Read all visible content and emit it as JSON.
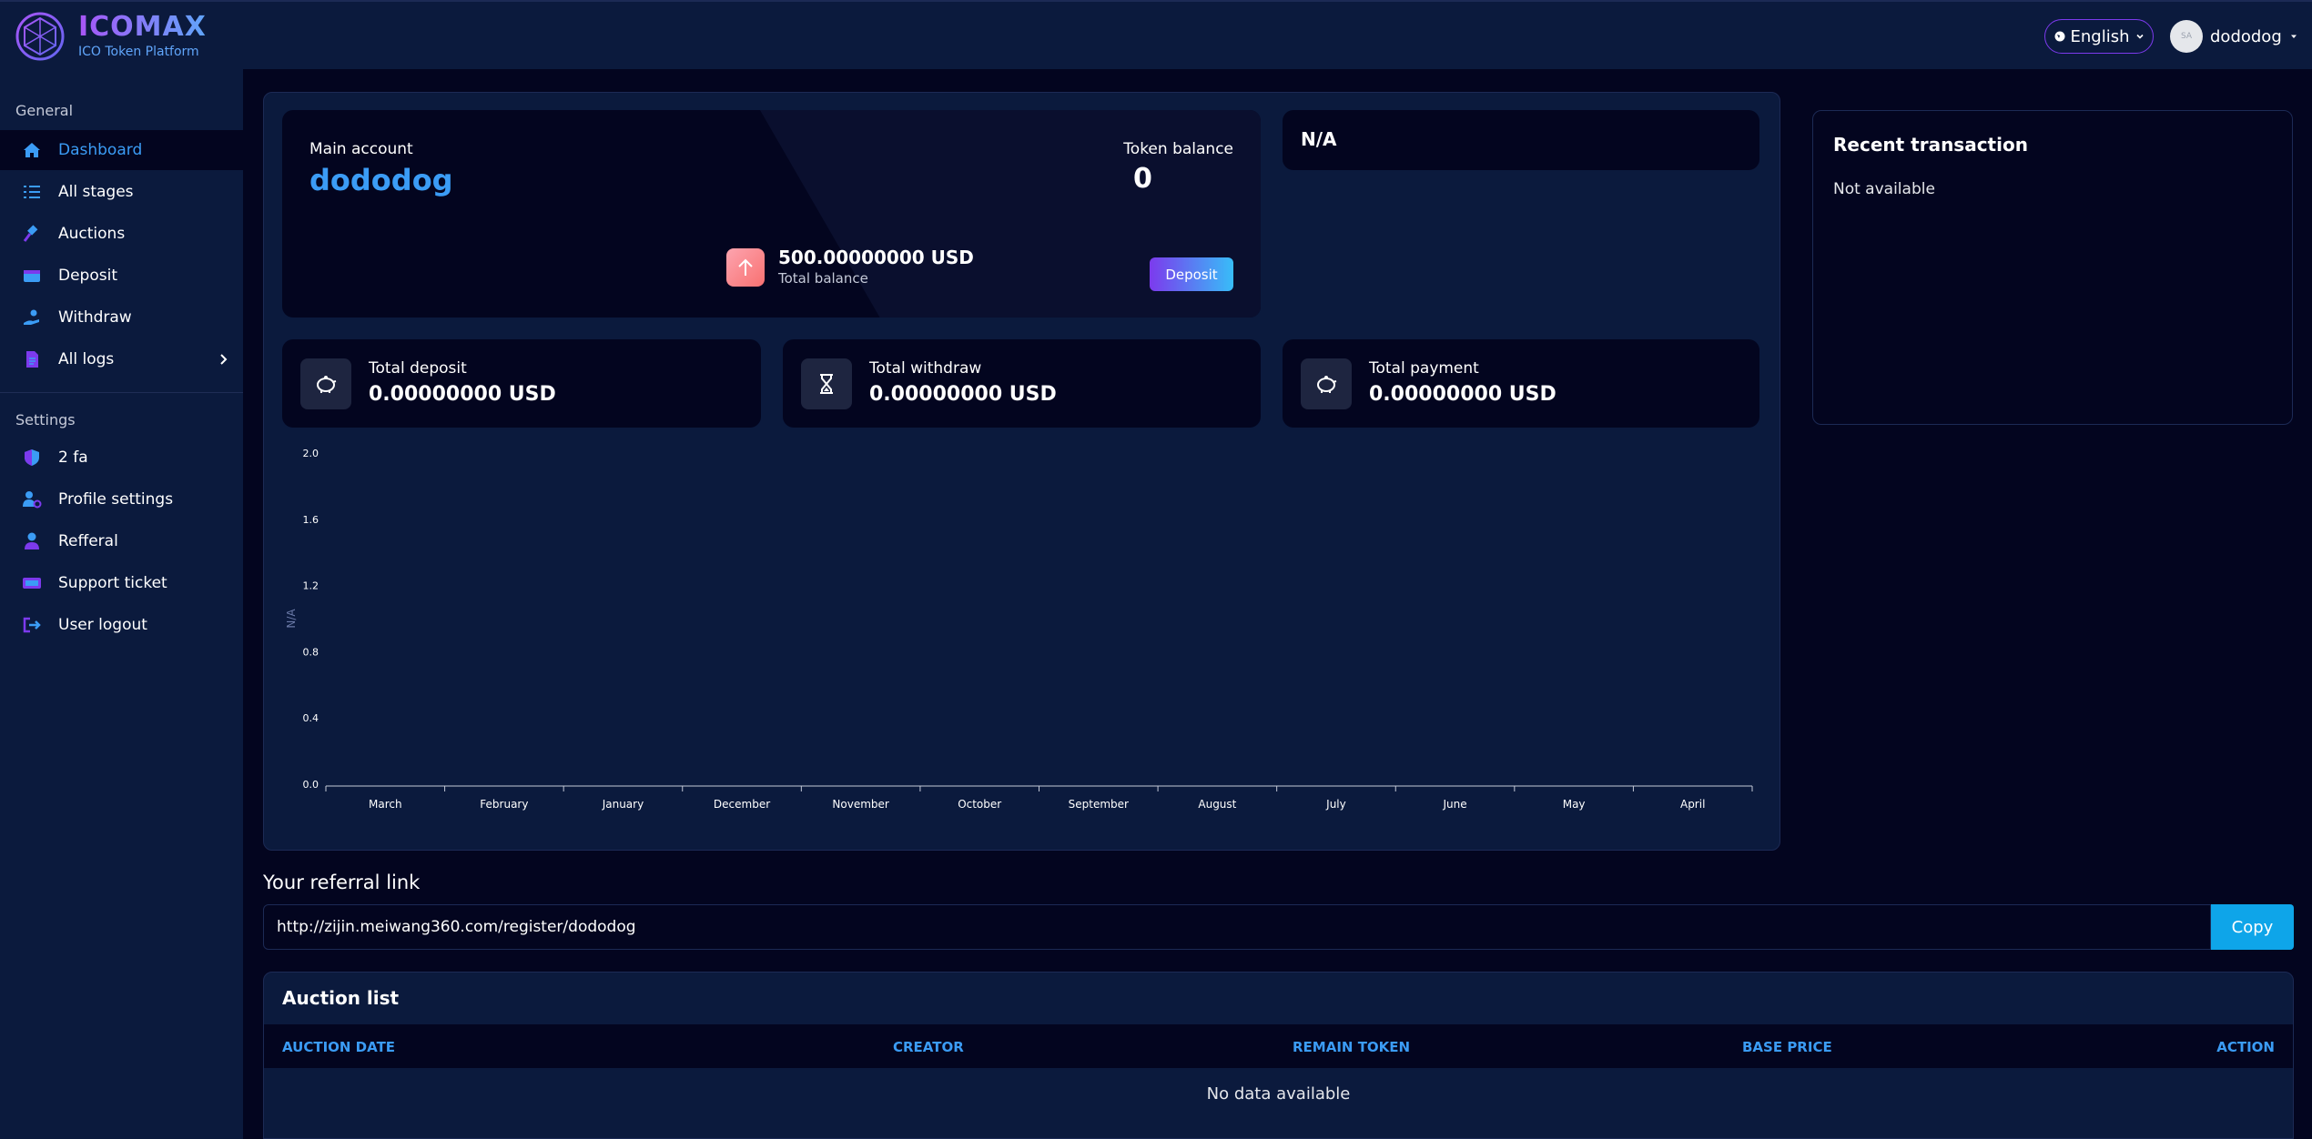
{
  "brand": {
    "title": "ICOMAX",
    "subtitle": "ICO Token Platform"
  },
  "topbar": {
    "language": "English",
    "username": "dododog",
    "avatar_text": "SA"
  },
  "sidebar": {
    "general_label": "General",
    "settings_label": "Settings",
    "general_items": [
      {
        "label": "Dashboard",
        "icon": "home-icon",
        "active": true
      },
      {
        "label": "All stages",
        "icon": "list-icon"
      },
      {
        "label": "Auctions",
        "icon": "gavel-icon"
      },
      {
        "label": "Deposit",
        "icon": "wallet-icon"
      },
      {
        "label": "Withdraw",
        "icon": "hand-coin-icon"
      },
      {
        "label": "All logs",
        "icon": "file-icon",
        "has_submenu": true
      }
    ],
    "settings_items": [
      {
        "label": "2 fa",
        "icon": "shield-icon"
      },
      {
        "label": "Profile settings",
        "icon": "user-gear-icon"
      },
      {
        "label": "Refferal",
        "icon": "user-icon"
      },
      {
        "label": "Support ticket",
        "icon": "ticket-icon"
      },
      {
        "label": "User logout",
        "icon": "logout-icon"
      }
    ]
  },
  "account": {
    "main_label": "Main account",
    "name": "dododog",
    "token_label": "Token balance",
    "token_value": "0",
    "total_balance": "500.00000000 USD",
    "total_balance_label": "Total balance",
    "deposit_label": "Deposit"
  },
  "na_card": {
    "text": "N/A"
  },
  "stats": [
    {
      "label": "Total deposit",
      "value": "0.00000000 USD",
      "icon": "piggy-bank-icon"
    },
    {
      "label": "Total withdraw",
      "value": "0.00000000 USD",
      "icon": "hourglass-icon"
    },
    {
      "label": "Total payment",
      "value": "0.00000000 USD",
      "icon": "piggy-bank-icon"
    }
  ],
  "chart_data": {
    "type": "line",
    "categories": [
      "March",
      "February",
      "January",
      "December",
      "November",
      "October",
      "September",
      "August",
      "July",
      "June",
      "May",
      "April"
    ],
    "series": [],
    "ylabel": "N/A",
    "ylim": [
      0,
      2.0
    ],
    "yticks": [
      "0.0",
      "0.4",
      "0.8",
      "1.2",
      "1.6",
      "2.0"
    ],
    "grid": false
  },
  "recent": {
    "title": "Recent transaction",
    "empty": "Not available"
  },
  "referral": {
    "title": "Your referral link",
    "link": "http://zijin.meiwang360.com/register/dododog",
    "copy_label": "Copy"
  },
  "auction": {
    "title": "Auction list",
    "columns": [
      "AUCTION DATE",
      "CREATOR",
      "REMAIN TOKEN",
      "BASE PRICE",
      "ACTION"
    ],
    "empty": "No data available"
  },
  "colors": {
    "accent": "#3b9cf5",
    "sidebar_bg": "#0b1a3d",
    "page_bg": "#03051f",
    "copy_btn": "#0ea5e9"
  }
}
